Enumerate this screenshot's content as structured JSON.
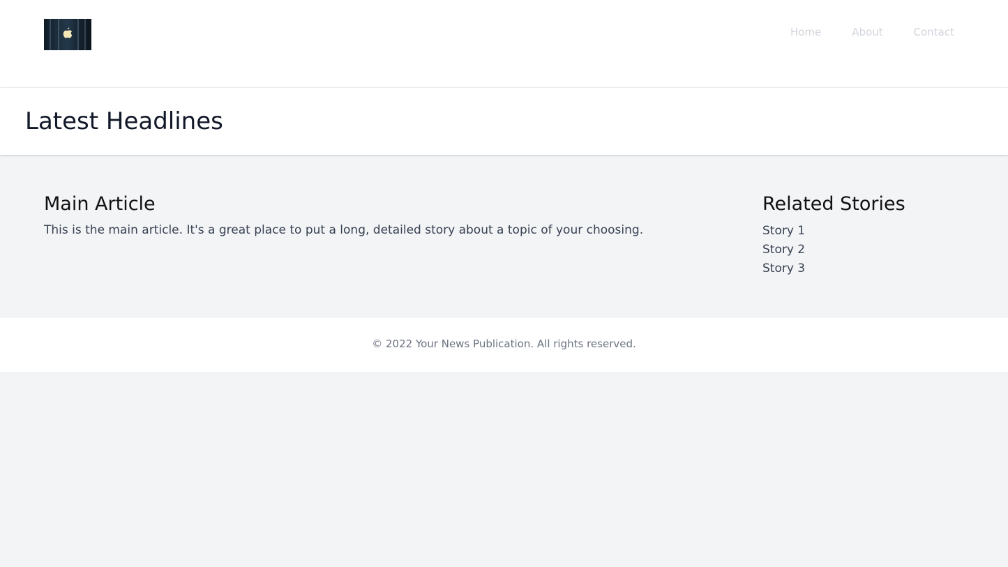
{
  "header": {
    "logo_icon": "apple-logo-icon",
    "nav": [
      {
        "label": "Home"
      },
      {
        "label": "About"
      },
      {
        "label": "Contact"
      }
    ],
    "nav_color": "#d1d5db"
  },
  "headline": {
    "title": "Latest Headlines"
  },
  "main_article": {
    "title": "Main Article",
    "body": "This is the main article. It's a great place to put a long, detailed story about a topic of your choosing."
  },
  "related": {
    "title": "Related Stories",
    "items": [
      {
        "label": "Story 1"
      },
      {
        "label": "Story 2"
      },
      {
        "label": "Story 3"
      }
    ]
  },
  "footer": {
    "text": "© 2022 Your News Publication. All rights reserved."
  },
  "colors": {
    "page_background": "#f3f4f6",
    "panel_background": "#ffffff",
    "heading_text": "#111827",
    "body_text": "#374151",
    "footer_text": "#6b7280"
  }
}
